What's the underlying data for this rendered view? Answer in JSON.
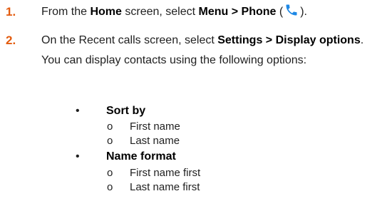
{
  "colors": {
    "step_number": "#e35b0e",
    "text": "#1f1f1f",
    "phone_icon": "#1e88e5"
  },
  "steps": [
    {
      "number": "1.",
      "text_1": "From the ",
      "bold_1": "Home",
      "text_2": " screen, select ",
      "bold_2": "Menu > Phone",
      "text_3": " (",
      "icon": "phone-icon",
      "text_4": ")."
    },
    {
      "number": "2.",
      "text_1": "On the Recent calls screen, select ",
      "bold_1": "Settings > Display options",
      "text_2": ". You can display contacts using the following options:"
    }
  ],
  "options": [
    {
      "label": "Sort by",
      "bullet": "•",
      "sub_marker": "o",
      "items": [
        "First name",
        "Last name"
      ]
    },
    {
      "label": "Name format",
      "bullet": "•",
      "sub_marker": "o",
      "items": [
        "First name first",
        "Last name first"
      ]
    }
  ]
}
